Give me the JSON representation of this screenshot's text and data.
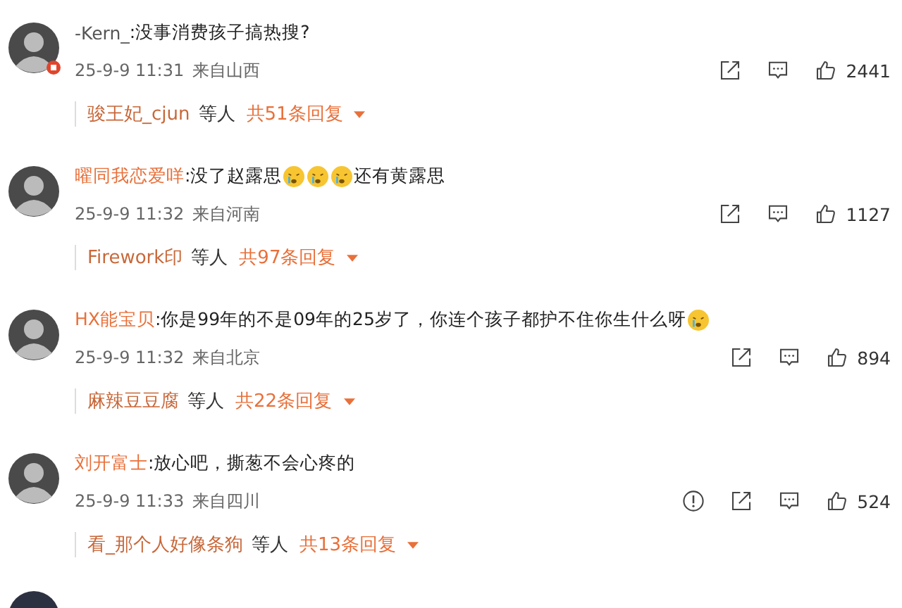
{
  "comments": [
    {
      "user": "-Kern_",
      "vip": false,
      "badge": true,
      "content": [
        {
          "kind": "text",
          "text": ":没事消费孩子搞热搜?"
        }
      ],
      "time": "25-9-9 11:31",
      "location": "来自山西",
      "actions": [
        {
          "kind": "share"
        },
        {
          "kind": "comment"
        }
      ],
      "likes": "2441",
      "reply_users": "骏王妃_cjun",
      "reply_suffix": "等人",
      "reply_count": "共51条回复"
    },
    {
      "user": "曜同我恋爱咩",
      "vip": true,
      "badge": false,
      "content": [
        {
          "kind": "text",
          "text": ":没了赵露思"
        },
        {
          "kind": "emoji"
        },
        {
          "kind": "emoji"
        },
        {
          "kind": "emoji"
        },
        {
          "kind": "text",
          "text": "还有黄露思"
        }
      ],
      "time": "25-9-9 11:32",
      "location": "来自河南",
      "actions": [
        {
          "kind": "share"
        },
        {
          "kind": "comment"
        }
      ],
      "likes": "1127",
      "reply_users": "Firework印",
      "reply_suffix": "等人",
      "reply_count": "共97条回复"
    },
    {
      "user": "HX能宝贝",
      "vip": true,
      "badge": false,
      "content": [
        {
          "kind": "text",
          "text": ":你是99年的不是09年的25岁了，你连个孩子都护不住你生什么呀"
        },
        {
          "kind": "emoji"
        }
      ],
      "time": "25-9-9 11:32",
      "location": "来自北京",
      "actions": [
        {
          "kind": "share"
        },
        {
          "kind": "comment"
        }
      ],
      "likes": "894",
      "reply_users": "麻辣豆豆腐",
      "reply_suffix": "等人",
      "reply_count": "共22条回复"
    },
    {
      "user": "刘开富士",
      "vip": true,
      "badge": false,
      "content": [
        {
          "kind": "text",
          "text": ":放心吧，撕葱不会心疼的"
        }
      ],
      "time": "25-9-9 11:33",
      "location": "来自四川",
      "actions": [
        {
          "kind": "report"
        },
        {
          "kind": "share"
        },
        {
          "kind": "comment"
        }
      ],
      "likes": "524",
      "reply_users": "看_那个人好像条狗",
      "reply_suffix": "等人",
      "reply_count": "共13条回复"
    }
  ]
}
